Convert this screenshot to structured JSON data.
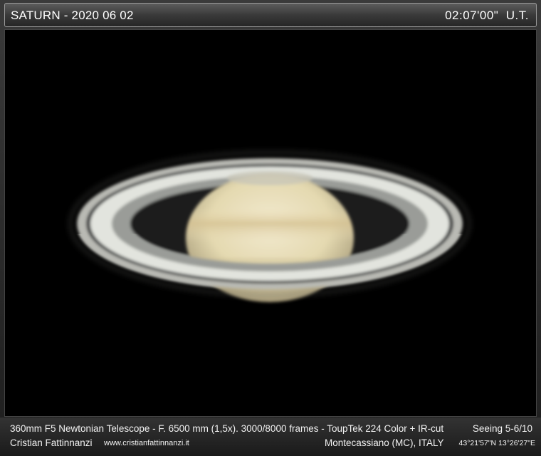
{
  "header": {
    "title": "SATURN - 2020 06 02",
    "time": "02:07'00\"  U.T."
  },
  "image": {
    "subject": "Saturn planet with rings",
    "colors": {
      "background": "#000000",
      "planet": "#e6ddb5",
      "rings": "#d8dcd6"
    }
  },
  "footer": {
    "equipment": "360mm F5 Newtonian Telescope - F. 6500 mm (1,5x). 3000/8000 frames - ToupTek 224 Color + IR-cut",
    "seeing": "Seeing 5-6/10",
    "author": "Cristian Fattinnanzi",
    "website": "www.cristianfattinnanzi.it",
    "location": "Montecassiano (MC), ITALY",
    "coordinates": "43°21'57\"N 13°26'27\"E"
  }
}
